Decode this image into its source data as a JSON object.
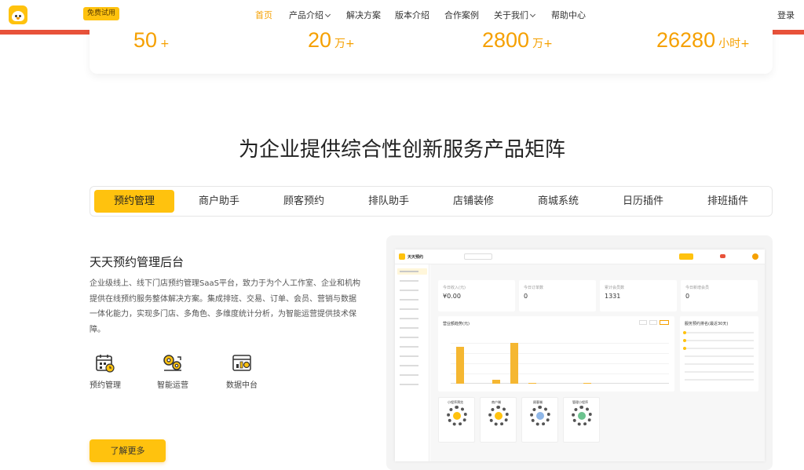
{
  "header": {
    "trial_label": "免费试用",
    "nav": [
      {
        "label": "首页"
      },
      {
        "label": "产品介绍"
      },
      {
        "label": "解决方案"
      },
      {
        "label": "版本介绍"
      },
      {
        "label": "合作案例"
      },
      {
        "label": "关于我们"
      },
      {
        "label": "帮助中心"
      }
    ],
    "login_label": "登录"
  },
  "stats": [
    {
      "value": "50",
      "unit": "+"
    },
    {
      "value": "20",
      "unit": "万+"
    },
    {
      "value": "2800",
      "unit": "万+"
    },
    {
      "value": "26280",
      "unit": "小时+"
    }
  ],
  "section_title": "为企业提供综合性创新服务产品矩阵",
  "tabs": [
    {
      "label": "预约管理"
    },
    {
      "label": "商户助手"
    },
    {
      "label": "顾客预约"
    },
    {
      "label": "排队助手"
    },
    {
      "label": "店铺装修"
    },
    {
      "label": "商城系统"
    },
    {
      "label": "日历插件"
    },
    {
      "label": "排班插件"
    }
  ],
  "content": {
    "title": "天天预约管理后台",
    "description": "企业级线上、线下门店预约管理SaaS平台，致力于为个人工作室、企业和机构提供在线预约服务整体解决方案。集成排班、交易、订单、会员、营销与数据一体化能力，实现多门店、多角色、多维度统计分析，为智能运营提供技术保障。",
    "features": [
      {
        "label": "预约管理",
        "icon": "calendar-icon"
      },
      {
        "label": "智能运营",
        "icon": "gears-icon"
      },
      {
        "label": "数据中台",
        "icon": "data-chart-icon"
      }
    ],
    "more_label": "了解更多"
  },
  "mock": {
    "brand": "天天预约",
    "kpis": [
      {
        "label": "今日收入(元)",
        "value": "¥0.00"
      },
      {
        "label": "今日订单数",
        "value": "0"
      },
      {
        "label": "累计会员数",
        "value": "1331"
      },
      {
        "label": "今日新增会员",
        "value": "0"
      }
    ],
    "chart_title": "营业额趋势(元)",
    "chart_data": {
      "type": "bar",
      "values": [
        0.9,
        0,
        0.1,
        1.0,
        0.02,
        0,
        0,
        0.02,
        0,
        0,
        0,
        0
      ]
    },
    "ranking_title": "服务预约排名(最近30天)",
    "miniapps": [
      {
        "label": "小程序预览"
      },
      {
        "label": "商户端"
      },
      {
        "label": "顾客端"
      },
      {
        "label": "管理小程序"
      }
    ]
  }
}
